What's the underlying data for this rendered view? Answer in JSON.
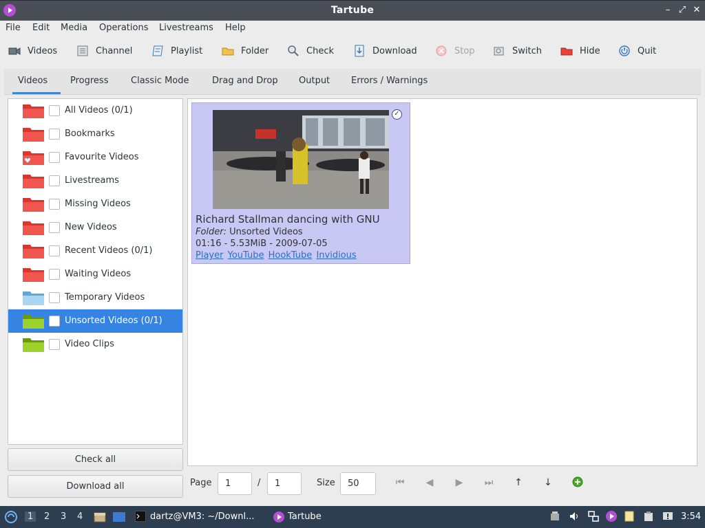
{
  "window": {
    "title": "Tartube"
  },
  "menubar": [
    "File",
    "Edit",
    "Media",
    "Operations",
    "Livestreams",
    "Help"
  ],
  "toolbar": [
    {
      "label": "Videos",
      "icon": "videos-icon"
    },
    {
      "label": "Channel",
      "icon": "channel-icon"
    },
    {
      "label": "Playlist",
      "icon": "playlist-icon"
    },
    {
      "label": "Folder",
      "icon": "folder-icon"
    },
    {
      "label": "Check",
      "icon": "check-icon"
    },
    {
      "label": "Download",
      "icon": "download-icon"
    },
    {
      "label": "Stop",
      "icon": "stop-icon",
      "disabled": true
    },
    {
      "label": "Switch",
      "icon": "switch-icon"
    },
    {
      "label": "Hide",
      "icon": "hide-icon"
    },
    {
      "label": "Quit",
      "icon": "quit-icon"
    }
  ],
  "tabs": [
    "Videos",
    "Progress",
    "Classic Mode",
    "Drag and Drop",
    "Output",
    "Errors / Warnings"
  ],
  "active_tab": "Videos",
  "folders": [
    {
      "label": "All Videos (0/1)",
      "color": "#e8423a"
    },
    {
      "label": "Bookmarks",
      "color": "#e8423a"
    },
    {
      "label": "Favourite Videos",
      "color": "#e8423a"
    },
    {
      "label": "Livestreams",
      "color": "#e8423a"
    },
    {
      "label": "Missing Videos",
      "color": "#e8423a"
    },
    {
      "label": "New Videos",
      "color": "#e8423a"
    },
    {
      "label": "Recent Videos (0/1)",
      "color": "#e8423a"
    },
    {
      "label": "Waiting Videos",
      "color": "#e8423a"
    },
    {
      "label": "Temporary Videos",
      "color": "#8ec7ee"
    },
    {
      "label": "Unsorted Videos (0/1)",
      "color": "#8cc21f",
      "selected": true
    },
    {
      "label": "Video Clips",
      "color": "#8cc21f"
    }
  ],
  "buttons": {
    "check_all": "Check all",
    "download_all": "Download all"
  },
  "video": {
    "title": "Richard Stallman dancing with GNU",
    "folder_key": "Folder:",
    "folder_value": "Unsorted Videos",
    "meta": "01:16  -  5.53MiB  -  2009-07-05",
    "links": [
      "Player",
      "YouTube",
      "HookTube",
      "Invidious"
    ],
    "card_color": "#c9c8f5"
  },
  "pager": {
    "page_label": "Page",
    "page": "1",
    "sep": "/",
    "total": "1",
    "size_label": "Size",
    "size": "50"
  },
  "taskbar": {
    "workspaces": [
      "1",
      "2",
      "3",
      "4"
    ],
    "terminal_label": "dartz@VM3: ~/Downl...",
    "app_label": "Tartube",
    "clock": "3:54"
  },
  "colors": {
    "accent": "#3584e4",
    "titlebar": "#4a4f57",
    "taskbar": "#2c3e50"
  }
}
